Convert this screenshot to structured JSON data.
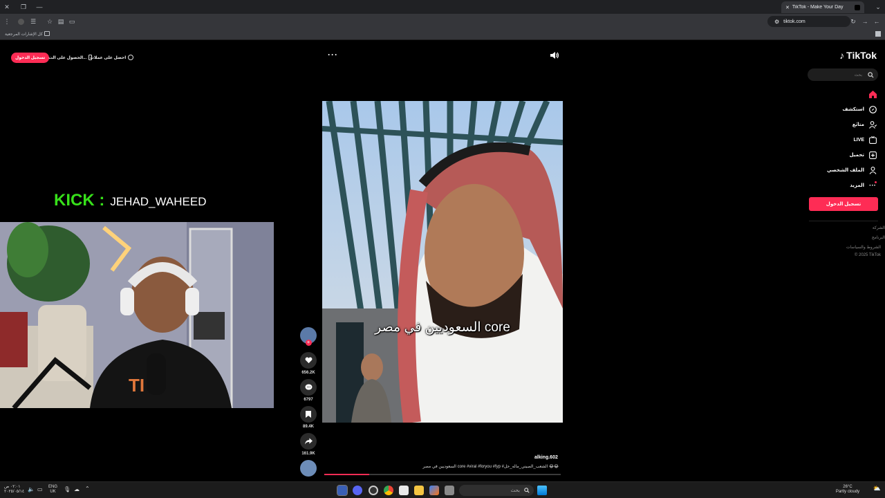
{
  "browser": {
    "tab_title": "TikTok - Make Your Day",
    "url": "tiktok.com",
    "bookmarks_label": "كل الإشارات المرجعية"
  },
  "header": {
    "login_pill": "تسجيل الدخول",
    "get_app": "الحصول على الت...",
    "coins": "احصل على عملات"
  },
  "overlay": {
    "kick_label": "KICK :",
    "kick_name": "JEHAD_WAHEED"
  },
  "video": {
    "subtitle": "السعوديين في مصر core",
    "author": "alking.602",
    "caption": "السعوديين في مصر core #viral #foryou #fyp #الشعب_الصيني_ماله_حل 😂😂",
    "progress_fraction": 0.19
  },
  "actions": {
    "likes": "656.2K",
    "comments": "6797",
    "saves": "89.4K",
    "shares": "161.9K"
  },
  "sidebar": {
    "logo": "TikTok",
    "search_placeholder": "بحث",
    "items": [
      {
        "label": "",
        "icon": "home-icon"
      },
      {
        "label": "استكشف",
        "icon": "compass-icon"
      },
      {
        "label": "متابَع",
        "icon": "following-icon"
      },
      {
        "label": "LIVE",
        "icon": "live-icon"
      },
      {
        "label": "تحميل",
        "icon": "upload-icon"
      },
      {
        "label": "الملف الشخصي",
        "icon": "profile-icon"
      },
      {
        "label": "المزيد",
        "icon": "more-icon"
      }
    ],
    "login_button": "تسجيل الدخول",
    "footer": [
      "الشركة",
      "البرنامج",
      "الشروط والسياسات",
      "© 2025 TikTok"
    ]
  },
  "taskbar": {
    "search": "بحث",
    "lang_top": "ENG",
    "lang_bottom": "UK",
    "time": "٠٢:٠١ ص",
    "date": "٢٠٢٥/٠٥/١٤",
    "weather_temp": "26°C",
    "weather_desc": "Partly cloudy"
  },
  "colors": {
    "accent": "#fe2c55",
    "kick_green": "#37e01a"
  }
}
